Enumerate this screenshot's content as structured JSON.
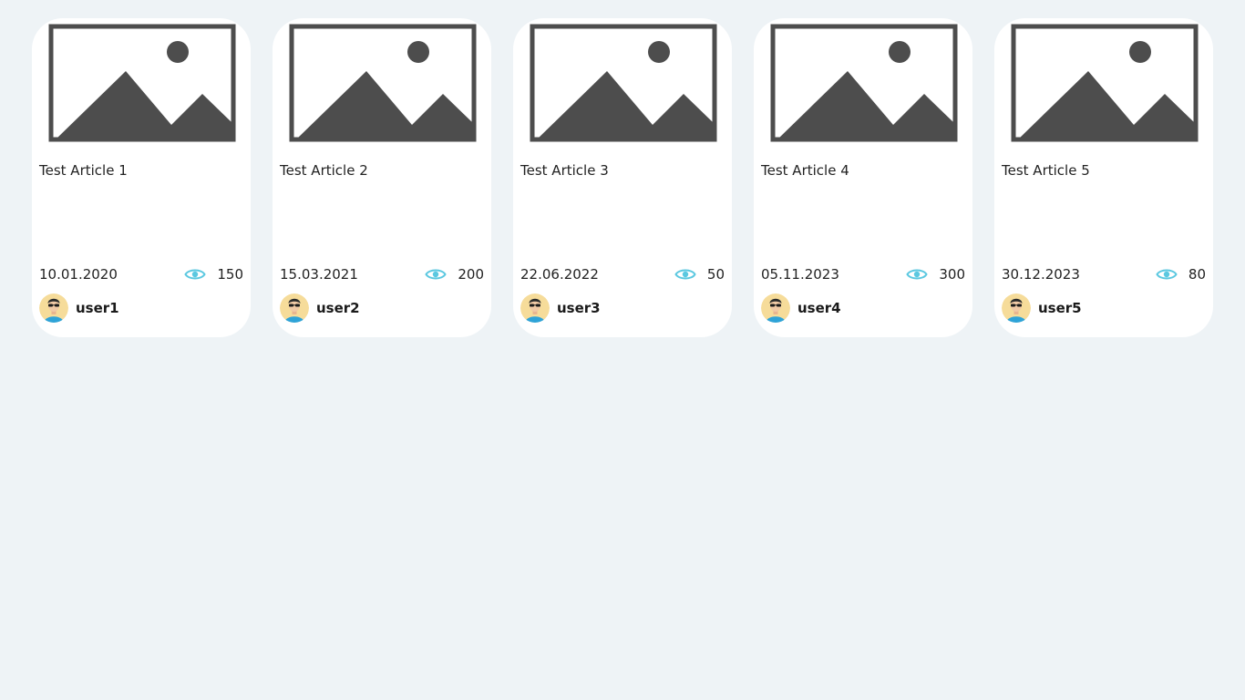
{
  "icons": {
    "thumbnail": "image-placeholder-icon",
    "views": "eye-icon",
    "avatar": "user-avatar"
  },
  "colors": {
    "background": "#eef3f6",
    "card": "#ffffff",
    "placeholder": "#4d4d4d",
    "eye": "#5bc8e0",
    "avatar_bg": "#f6dc9a",
    "avatar_shirt": "#2ea3d8"
  },
  "articles": [
    {
      "title": "Test Article 1",
      "date": "10.01.2020",
      "views": "150",
      "author": "user1"
    },
    {
      "title": "Test Article 2",
      "date": "15.03.2021",
      "views": "200",
      "author": "user2"
    },
    {
      "title": "Test Article 3",
      "date": "22.06.2022",
      "views": "50",
      "author": "user3"
    },
    {
      "title": "Test Article 4",
      "date": "05.11.2023",
      "views": "300",
      "author": "user4"
    },
    {
      "title": "Test Article 5",
      "date": "30.12.2023",
      "views": "80",
      "author": "user5"
    }
  ]
}
